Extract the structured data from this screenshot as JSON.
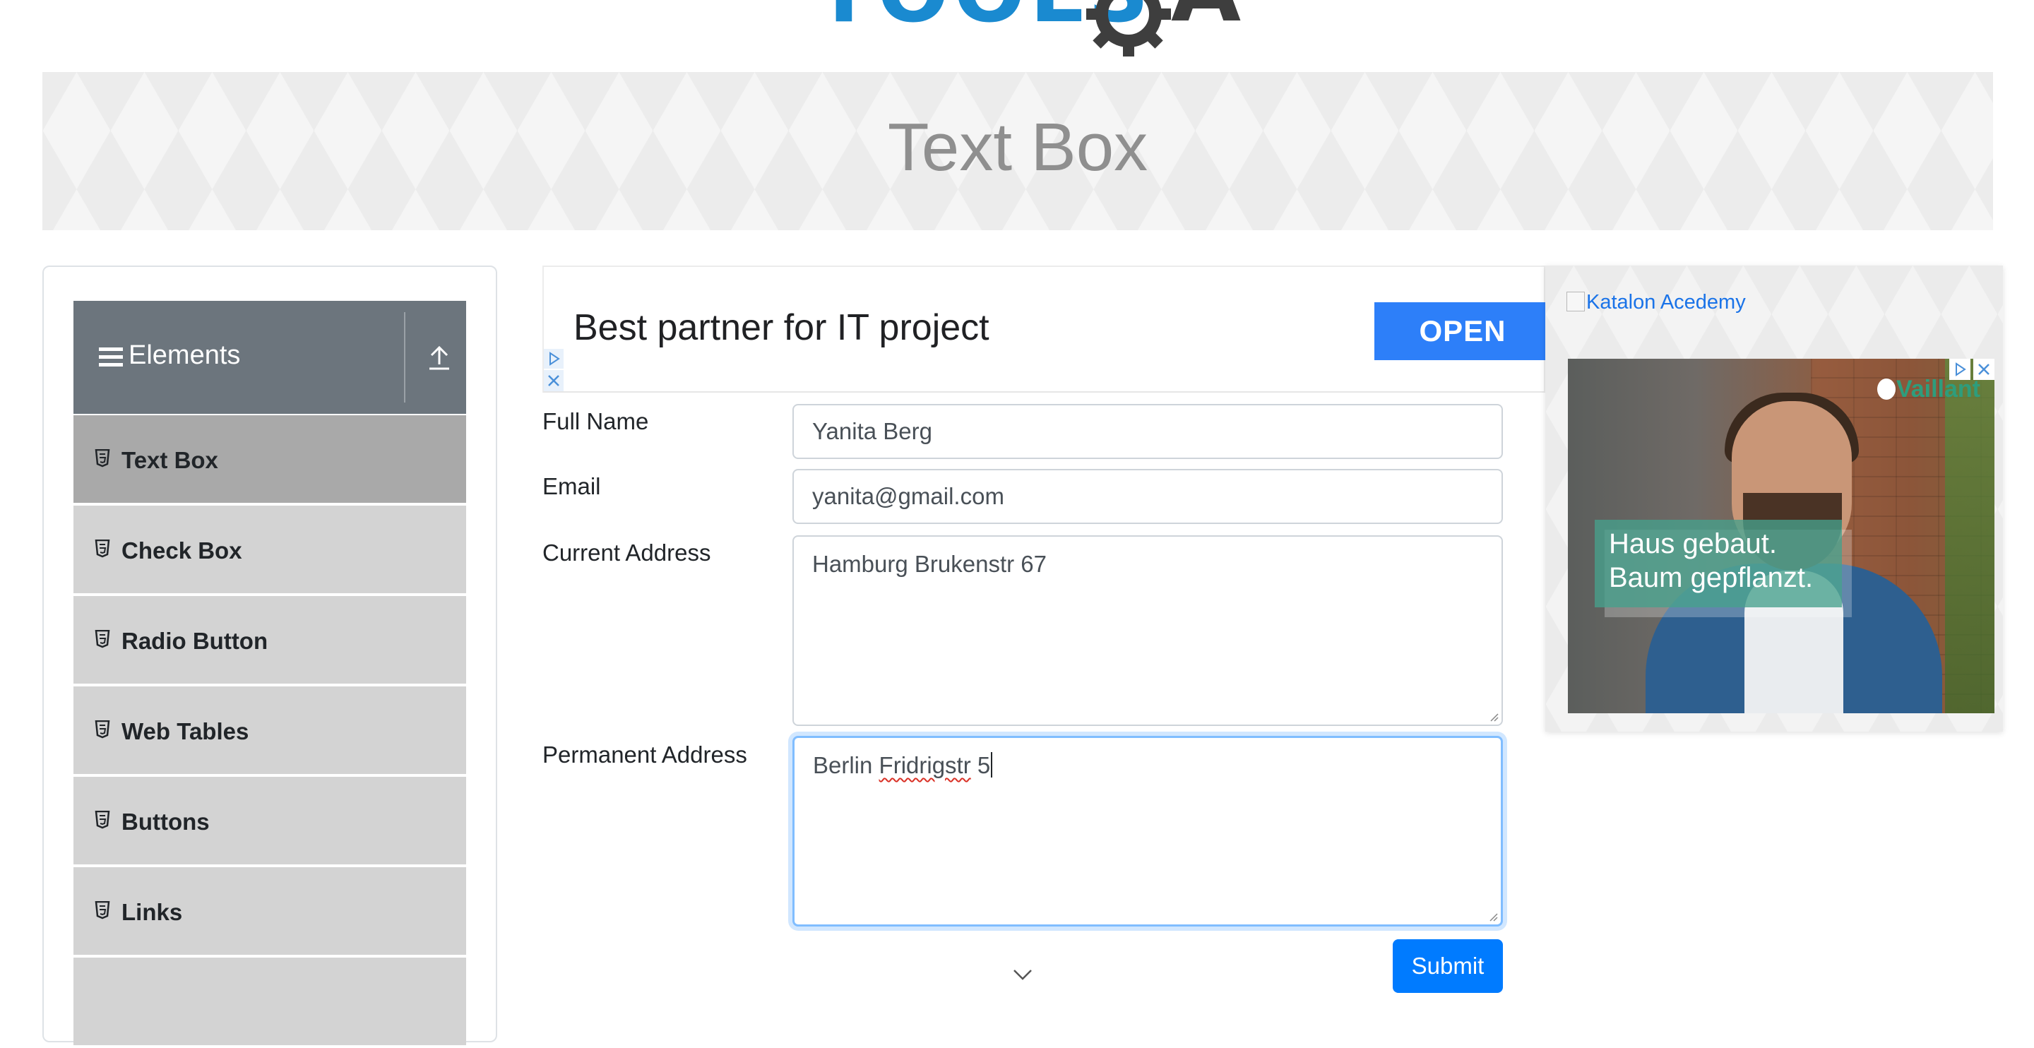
{
  "page": {
    "title": "Text Box"
  },
  "sidebar": {
    "group_title": "Elements",
    "items": [
      {
        "label": "Text Box"
      },
      {
        "label": "Check Box"
      },
      {
        "label": "Radio Button"
      },
      {
        "label": "Web Tables"
      },
      {
        "label": "Buttons"
      },
      {
        "label": "Links"
      }
    ]
  },
  "ad_strip": {
    "headline": "Best partner for IT project",
    "cta": "OPEN"
  },
  "form": {
    "full_name": {
      "label": "Full Name",
      "value": "Yanita Berg"
    },
    "email": {
      "label": "Email",
      "value": "yanita@gmail.com"
    },
    "current_address": {
      "label": "Current Address",
      "value": "Hamburg Brukenstr 67"
    },
    "permanent_address": {
      "label": "Permanent Address",
      "value_part1": "Berlin ",
      "value_misspelled": "Fridrigstr",
      "value_part2": " 5"
    },
    "submit_label": "Submit"
  },
  "right_ad": {
    "image_link_text": "Katalon Acedemy",
    "caption_line1": "Haus gebaut.",
    "caption_line2": "Baum gepflanzt.",
    "brand": "Vaillant"
  },
  "colors": {
    "primary": "#007bff",
    "sidebar_header": "#6c757d",
    "sidebar_item": "#d3d3d3",
    "sidebar_item_active": "#a9a9a9",
    "ad_cta": "#2d7ff9"
  }
}
